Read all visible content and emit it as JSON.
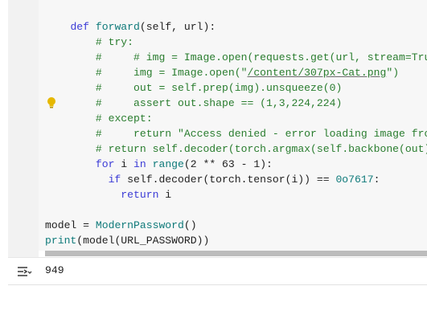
{
  "code": {
    "lines": [
      [
        "    ",
        "def",
        " ",
        "forward",
        "(self, url):"
      ],
      [
        "        ",
        "# try:"
      ],
      [
        "        ",
        "#     # img = Image.open(requests.get(url, stream=True"
      ],
      [
        "        ",
        "#     img = Image.open(\"/content/307px-Cat.png\")"
      ],
      [
        "        ",
        "#     out = self.prep(img).unsqueeze(0)"
      ],
      [
        "        ",
        "#     assert out.shape == (1,3,224,224)"
      ],
      [
        "        ",
        "# except:"
      ],
      [
        "        ",
        "#     return \"Access denied - error loading image from"
      ],
      [
        "        ",
        "# return self.decoder(torch.argmax(self.backbone(out))"
      ],
      [
        "        ",
        "for",
        " i ",
        "in",
        " ",
        "range",
        "(2 ** 63 - 1):"
      ],
      [
        "          ",
        "if",
        " self.decoder(torch.tensor(i)) == ",
        "0o7617",
        ":"
      ],
      [
        "            ",
        "return",
        " i"
      ],
      [
        ""
      ],
      [
        "model = ",
        "ModernPassword",
        "()"
      ],
      [
        "print",
        "(model(URL_PASSWORD))"
      ]
    ]
  },
  "output": {
    "icon": "output-toggle-icon",
    "text": "949"
  },
  "icons": {
    "hint": "lightbulb-icon"
  }
}
